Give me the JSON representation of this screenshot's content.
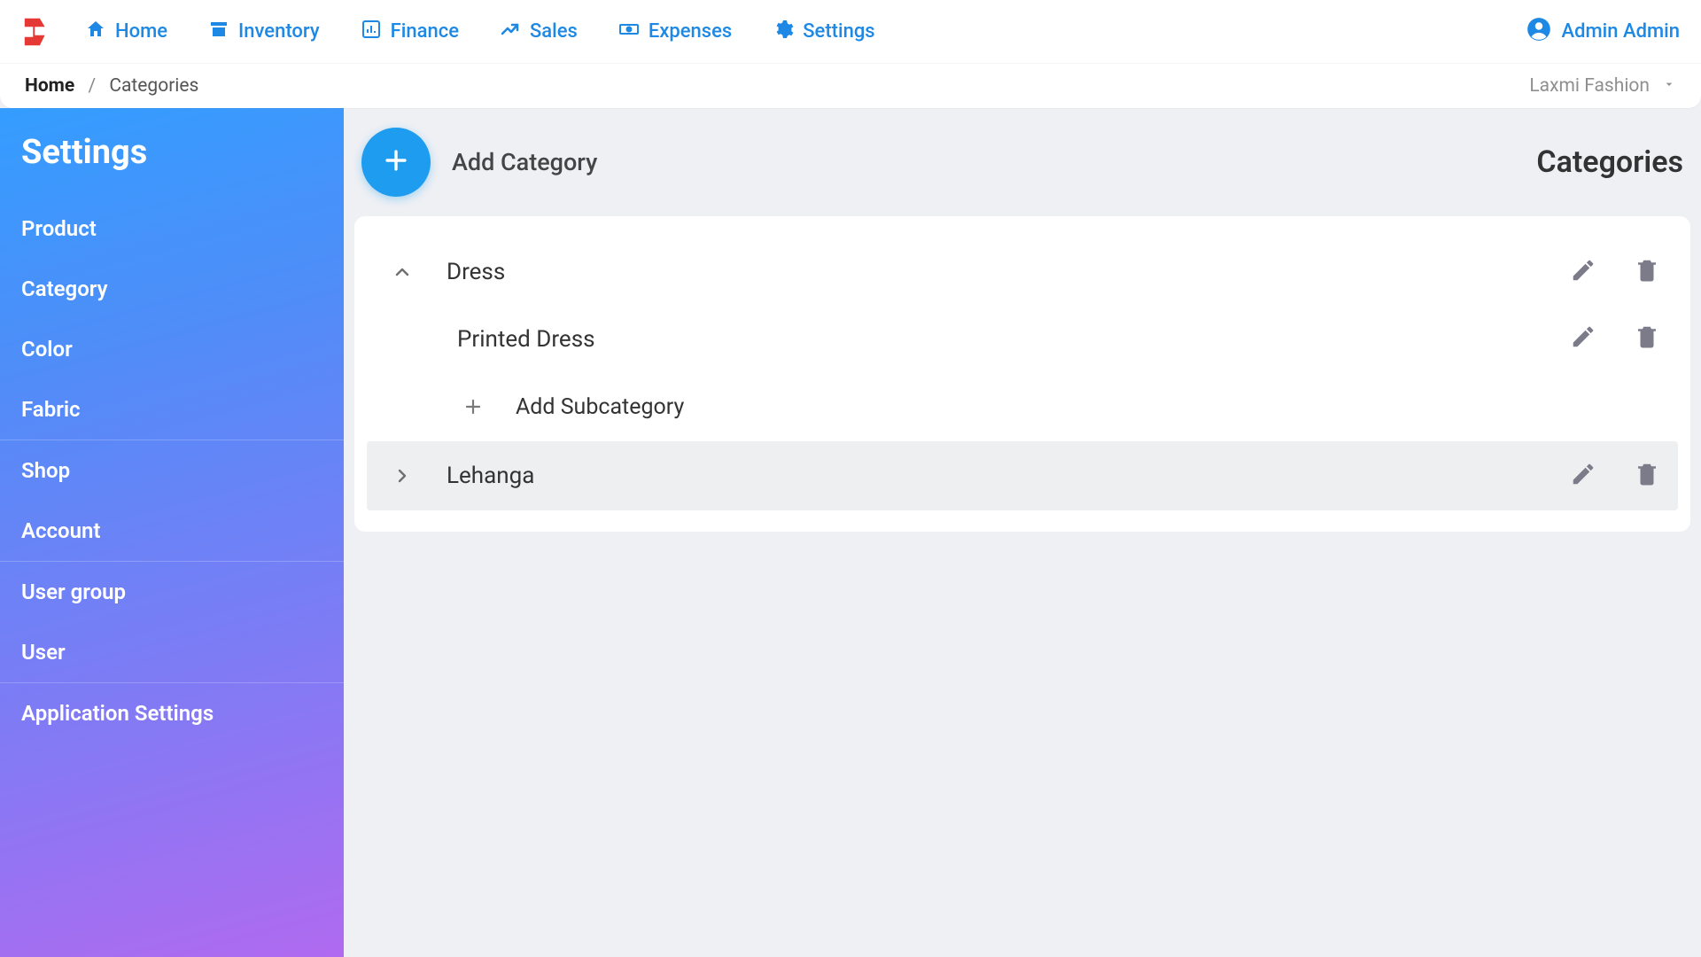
{
  "brand": "LF",
  "nav": {
    "home": "Home",
    "inventory": "Inventory",
    "finance": "Finance",
    "sales": "Sales",
    "expenses": "Expenses",
    "settings": "Settings"
  },
  "user": {
    "display_name": "Admin Admin"
  },
  "breadcrumb": {
    "root": "Home",
    "current": "Categories"
  },
  "store_selector": {
    "selected": "Laxmi Fashion"
  },
  "sidebar": {
    "title": "Settings",
    "links": {
      "product": "Product",
      "category": "Category",
      "color": "Color",
      "fabric": "Fabric",
      "shop": "Shop",
      "account": "Account",
      "user_group": "User group",
      "user": "User",
      "app_settings": "Application Settings"
    }
  },
  "main": {
    "add_category_label": "Add Category",
    "page_title": "Categories",
    "add_subcategory_label": "Add Subcategory",
    "categories": {
      "dress": {
        "name": "Dress",
        "expanded": true,
        "children": {
          "printed_dress": "Printed Dress"
        }
      },
      "lehanga": {
        "name": "Lehanga",
        "expanded": false
      }
    }
  }
}
